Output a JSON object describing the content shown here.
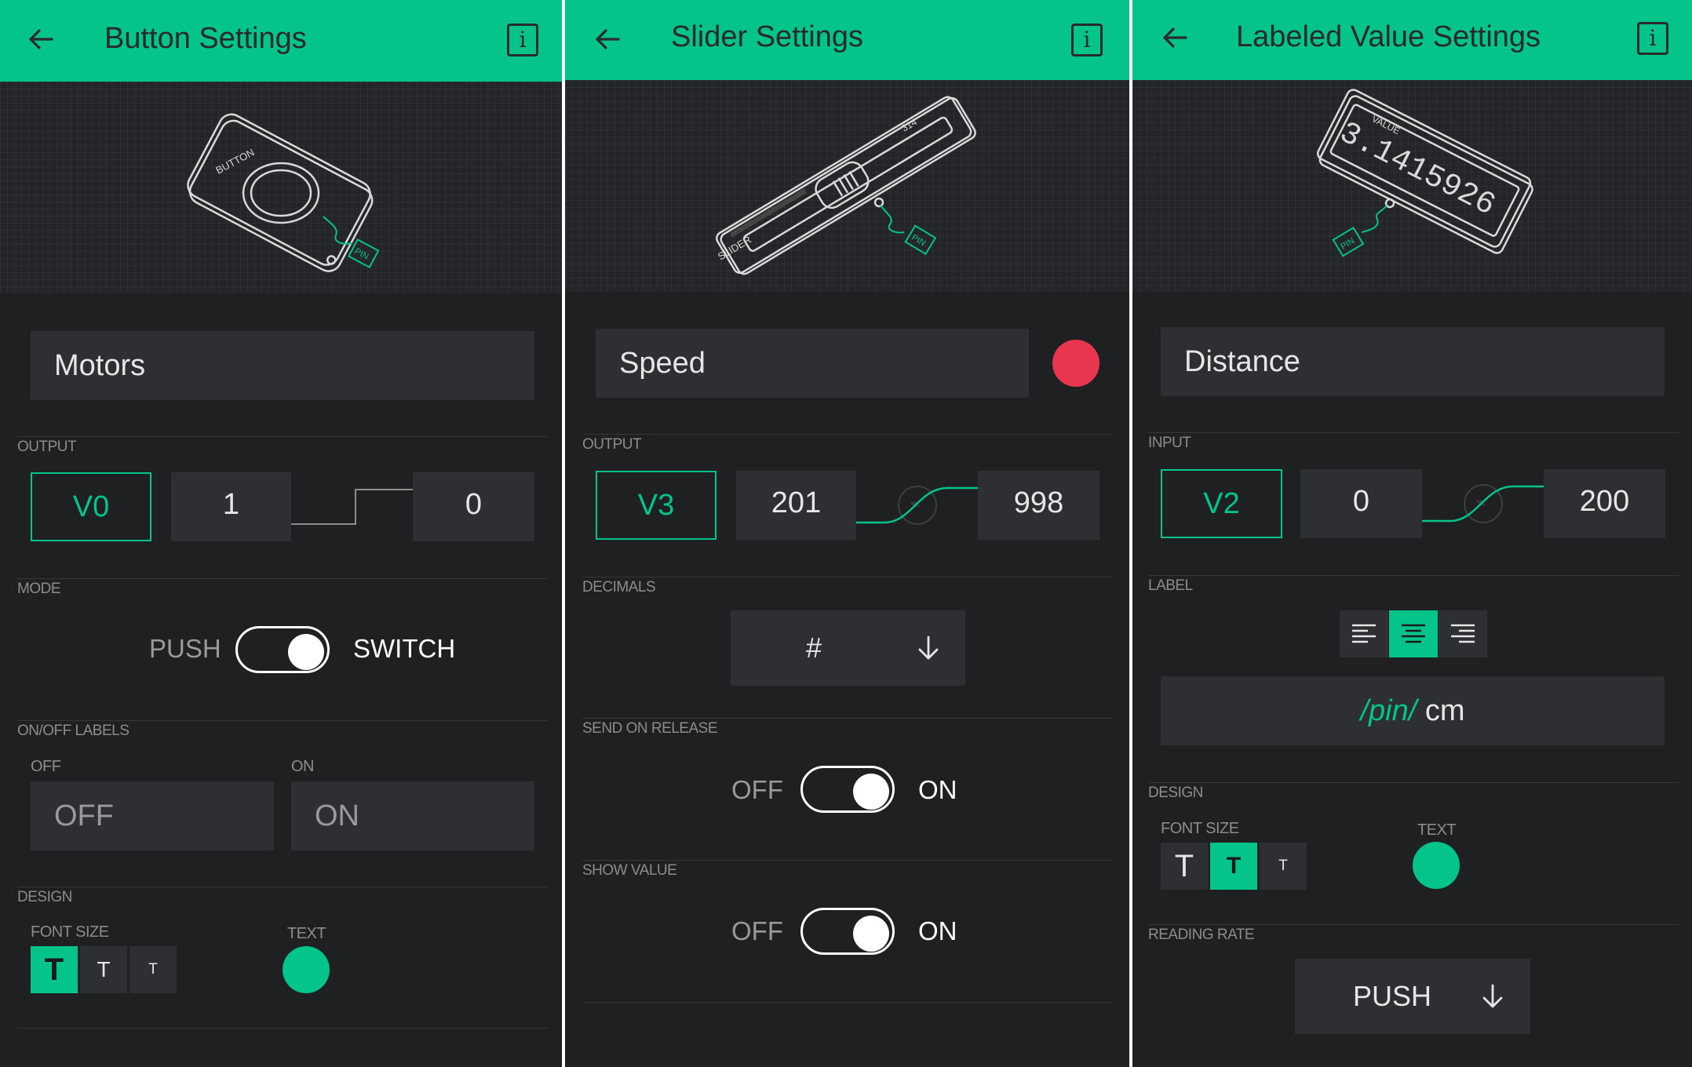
{
  "colors": {
    "accent": "#04c48b",
    "panel_bg": "#1f2022",
    "field_bg": "#2e2f32",
    "red": "#e8364e"
  },
  "button_settings": {
    "title": "Button Settings",
    "name_value": "Motors",
    "preview_label": "BUTTON",
    "preview_pin": "PIN",
    "output_label": "OUTPUT",
    "pin": "V0",
    "high": "1",
    "low": "0",
    "mode_label": "MODE",
    "mode_left": "PUSH",
    "mode_right": "SWITCH",
    "mode_value": "SWITCH",
    "onoff_label": "ON/OFF LABELS",
    "off_sub": "OFF",
    "on_sub": "ON",
    "off_value": "OFF",
    "on_value": "ON",
    "design_label": "DESIGN",
    "font_size_label": "FONT SIZE",
    "text_label": "TEXT",
    "font_size_selected": "large",
    "text_color": "#04c48b",
    "font_sizes": [
      "T",
      "T",
      "T"
    ]
  },
  "slider_settings": {
    "title": "Slider Settings",
    "name_value": "Speed",
    "preview_label": "SLIDER",
    "preview_value": "314",
    "preview_pin": "PIN",
    "color": "#e8364e",
    "output_label": "OUTPUT",
    "pin": "V3",
    "min": "201",
    "max": "998",
    "decimals_label": "DECIMALS",
    "decimals_value": "#",
    "send_on_release_label": "SEND ON RELEASE",
    "send_off": "OFF",
    "send_on": "ON",
    "send_on_release": "ON",
    "show_value_label": "SHOW VALUE",
    "show_off": "OFF",
    "show_on": "ON",
    "show_value": "ON"
  },
  "labeled_value_settings": {
    "title": "Labeled Value Settings",
    "name_value": "Distance",
    "preview_label": "VALUE",
    "preview_value": "3.1415926",
    "preview_pin": "PIN",
    "input_label": "INPUT",
    "pin": "V2",
    "min": "0",
    "max": "200",
    "label_label": "LABEL",
    "label_alignment": "center",
    "label_pin": "/pin/",
    "label_unit": "cm",
    "design_label": "DESIGN",
    "font_size_label": "FONT SIZE",
    "text_label": "TEXT",
    "font_size_selected": "medium",
    "text_color": "#04c48b",
    "font_sizes": [
      "T",
      "T",
      "T"
    ],
    "reading_rate_label": "READING RATE",
    "reading_rate": "PUSH"
  }
}
